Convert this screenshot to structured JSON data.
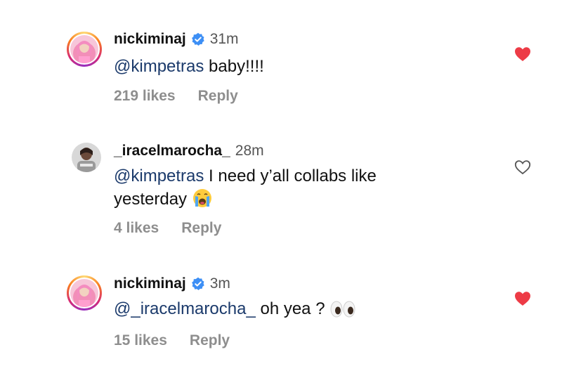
{
  "comments": [
    {
      "username": "nickiminaj",
      "verified": true,
      "time": "31m",
      "mention": "@kimpetras",
      "text_rest": " baby!!!!",
      "likes": "219 likes",
      "reply": "Reply",
      "liked": true,
      "avatar_icon": "pink-haired-avatar",
      "story_ring": true
    },
    {
      "username": "_iracelmarocha_",
      "verified": false,
      "time": "28m",
      "mention": "@kimpetras",
      "text_rest": " I need y’all collabs like",
      "text_line2": "yesterday",
      "emoji": "loudly-crying-face",
      "likes": "4 likes",
      "reply": "Reply",
      "liked": false,
      "avatar_icon": "selfie-avatar",
      "story_ring": false
    },
    {
      "username": "nickiminaj",
      "verified": true,
      "time": "3m",
      "mention": "@_iracelmarocha_",
      "text_rest": " oh yea ?",
      "emoji": "eyes",
      "likes": "15 likes",
      "reply": "Reply",
      "liked": true,
      "avatar_icon": "pink-haired-avatar",
      "story_ring": true
    }
  ],
  "colors": {
    "liked_heart": "#ed3b46",
    "verified_badge": "#3d8ff5",
    "mention": "#1b3a6b",
    "meta": "#8e8e8e"
  }
}
